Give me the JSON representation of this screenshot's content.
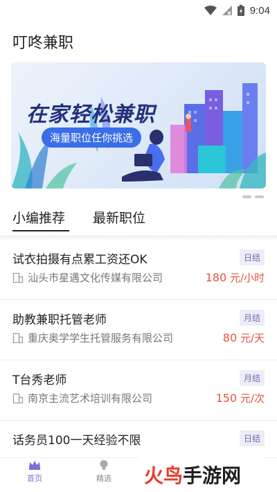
{
  "status_bar": {
    "time": "9:04",
    "icons": [
      "wifi-icon",
      "signal-icon",
      "battery-icon"
    ]
  },
  "app": {
    "title": "叮咚兼职"
  },
  "banner": {
    "headline": "在家轻松兼职",
    "subtitle": "海量职位任你挑选"
  },
  "tabs": [
    {
      "label": "小编推荐",
      "active": true
    },
    {
      "label": "最新职位",
      "active": false
    }
  ],
  "jobs": [
    {
      "title": "试衣拍摄有点累工资还OK",
      "tag": "日结",
      "company": "汕头市星遇文化传媒有限公司",
      "amount": "180",
      "unit": "元/小时"
    },
    {
      "title": "助教兼职托管老师",
      "tag": "月结",
      "company": "重庆奥学学生托管服务有限公司",
      "amount": "80",
      "unit": "元/天"
    },
    {
      "title": "T台秀老师",
      "tag": "月结",
      "company": "南京主流艺术培训有限公司",
      "amount": "150",
      "unit": "元/次"
    },
    {
      "title": "话务员100一天经验不限",
      "tag": "日结",
      "company": "",
      "amount": "",
      "unit": ""
    }
  ],
  "bottom_nav": [
    {
      "label": "首页",
      "icon": "crown-icon",
      "active": true
    },
    {
      "label": "精选",
      "icon": "bulb-icon",
      "active": false
    }
  ],
  "watermark": {
    "part1": "火鸟",
    "part2": "手游网"
  },
  "colors": {
    "accent": "#7b6fd6",
    "salary": "#e5553c",
    "tag_bg": "#ededf7",
    "tag_text": "#6c6cb3"
  }
}
